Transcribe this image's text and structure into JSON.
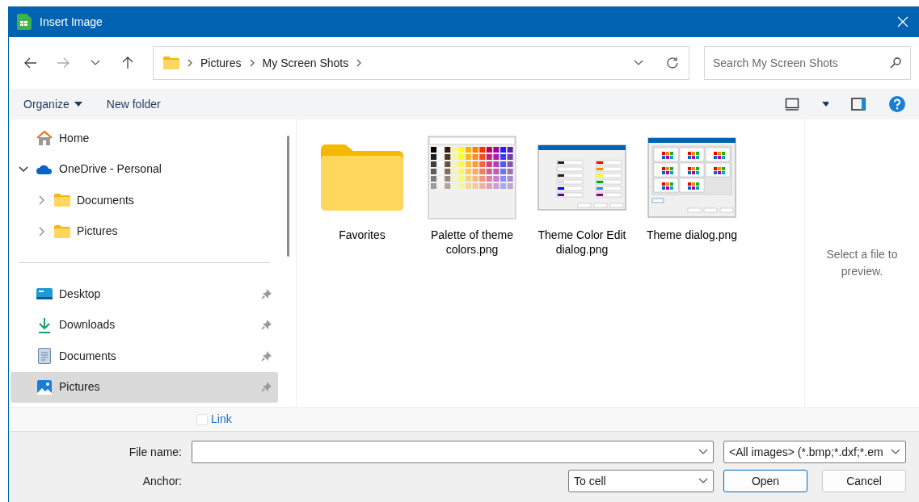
{
  "window": {
    "title": "Insert Image"
  },
  "address": {
    "path": [
      "Pictures",
      "My Screen Shots"
    ]
  },
  "search": {
    "placeholder": "Search My Screen Shots"
  },
  "toolbar": {
    "organize": "Organize",
    "new_folder": "New folder"
  },
  "sidebar": {
    "groups": [
      [
        {
          "label": "Home",
          "kind": "home",
          "selected": false
        },
        {
          "label": "OneDrive - Personal",
          "kind": "cloud",
          "expanded": true,
          "selected": false,
          "children": [
            {
              "label": "Documents",
              "kind": "folder",
              "expanded": false,
              "selected": false
            },
            {
              "label": "Pictures",
              "kind": "folder",
              "expanded": false,
              "selected": false
            }
          ]
        }
      ],
      [
        {
          "label": "Desktop",
          "kind": "desktop",
          "pinned": true,
          "selected": false
        },
        {
          "label": "Downloads",
          "kind": "downloads",
          "pinned": true,
          "selected": false
        },
        {
          "label": "Documents",
          "kind": "documents",
          "pinned": true,
          "selected": false
        },
        {
          "label": "Pictures",
          "kind": "pictures",
          "pinned": true,
          "selected": true
        }
      ]
    ]
  },
  "files": [
    {
      "name": "Favorites",
      "kind": "folder"
    },
    {
      "name": "Palette of theme colors.png",
      "kind": "palette"
    },
    {
      "name": "Theme Color Edit dialog.png",
      "kind": "form"
    },
    {
      "name": "Theme dialog.png",
      "kind": "grid"
    }
  ],
  "preview": {
    "message": "Select a file to preview."
  },
  "link": {
    "label": "Link",
    "checked": false
  },
  "file_name": {
    "label": "File name:"
  },
  "file_type": {
    "value": "<All images> (*.bmp;*.dxf;*.em"
  },
  "anchor": {
    "label": "Anchor:",
    "value": "To cell"
  },
  "buttons": [
    {
      "label": "Open",
      "default": true
    },
    {
      "label": "Cancel",
      "default": false
    }
  ]
}
